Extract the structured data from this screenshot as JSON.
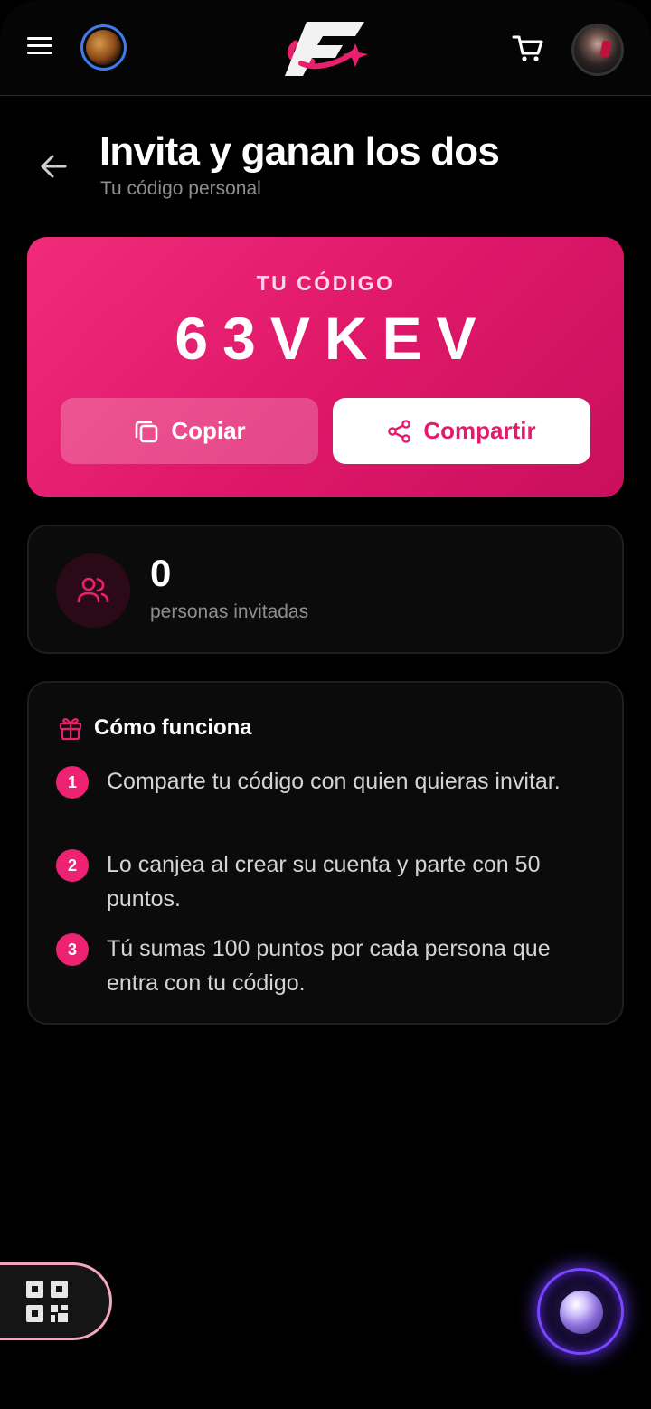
{
  "header": {
    "menu_icon": "hamburger-menu-icon",
    "planet_icon": "planet-avatar-icon",
    "logo": "brand-logo",
    "cart_icon": "cart-icon",
    "profile_icon": "profile-avatar"
  },
  "page": {
    "title": "Invita y ganan los dos",
    "subtitle": "Tu código personal",
    "back_icon": "arrow-left-icon"
  },
  "code_card": {
    "label": "TU CÓDIGO",
    "code": "63VKEV",
    "copy_label": "Copiar",
    "share_label": "Compartir"
  },
  "stats": {
    "count": "0",
    "label": "personas invitadas"
  },
  "how_it_works": {
    "title": "Cómo funciona",
    "steps": [
      {
        "num": "1",
        "text": "Comparte tu código con quien quieras invitar."
      },
      {
        "num": "2",
        "text": "Lo canjea al crear su cuenta y parte con 50 puntos."
      },
      {
        "num": "3",
        "text": "Tú sumas 100 puntos por cada persona que entra con tu código."
      }
    ]
  },
  "colors": {
    "accent": "#e51a6e",
    "background": "#000000",
    "card": "#0b0b0b"
  }
}
